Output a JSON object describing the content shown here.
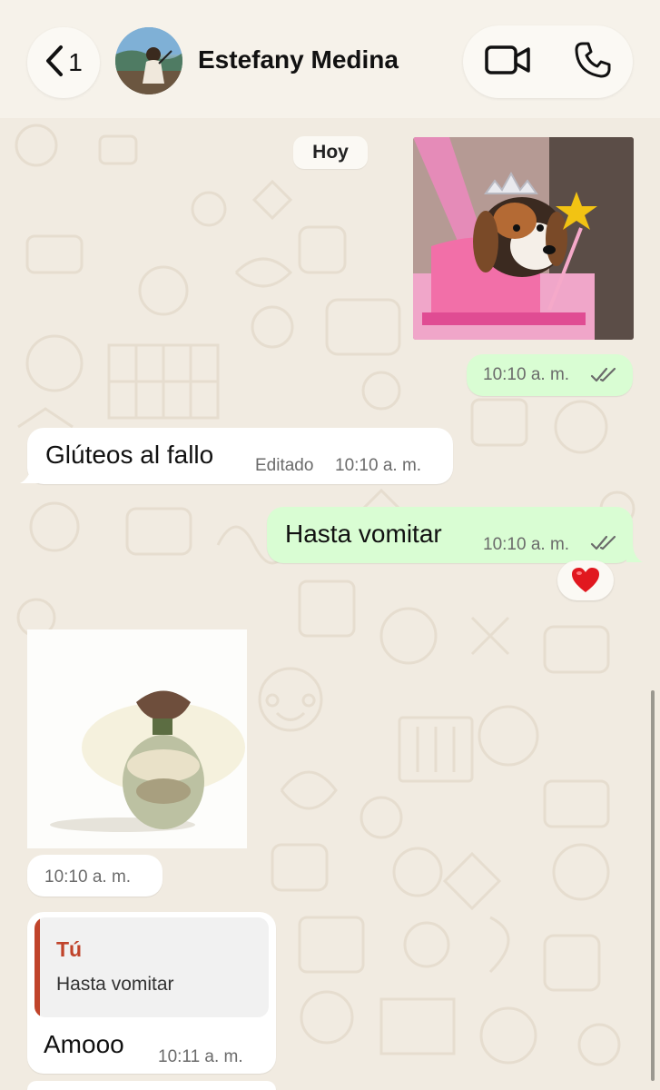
{
  "header": {
    "back_count": "1",
    "contact_name": "Estefany Medina"
  },
  "chat": {
    "date_chip": "Hoy",
    "messages": [
      {
        "type": "image",
        "direction": "outgoing",
        "description": "beagle puppy with tiara and star wand",
        "time": "10:10 a. m.",
        "read": true
      },
      {
        "type": "text",
        "direction": "incoming",
        "text": "Glúteos al fallo",
        "edited_label": "Editado",
        "time": "10:10 a. m."
      },
      {
        "type": "text",
        "direction": "outgoing",
        "text": "Hasta vomitar",
        "time": "10:10 a. m.",
        "read": true,
        "reaction": "❤️"
      },
      {
        "type": "sticker",
        "direction": "incoming",
        "time": "10:10 a. m."
      },
      {
        "type": "reply",
        "direction": "incoming",
        "quoted_author": "Tú",
        "quoted_text": "Hasta vomitar",
        "text": "Amooo",
        "time": "10:11 a. m."
      }
    ]
  },
  "colors": {
    "outgoing_bubble": "#d9fdd3",
    "incoming_bubble": "#ffffff",
    "quote_accent": "#c0442b",
    "read_ticks": "#6b6b6b"
  },
  "icons": [
    "chevron-left-icon",
    "video-camera-icon",
    "phone-icon",
    "double-check-icon",
    "heart-emoji"
  ]
}
